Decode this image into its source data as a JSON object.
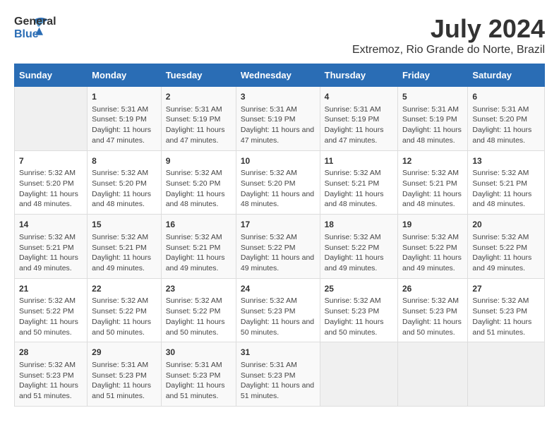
{
  "logo": {
    "text_general": "General",
    "text_blue": "Blue"
  },
  "title": "July 2024",
  "subtitle": "Extremoz, Rio Grande do Norte, Brazil",
  "days_of_week": [
    "Sunday",
    "Monday",
    "Tuesday",
    "Wednesday",
    "Thursday",
    "Friday",
    "Saturday"
  ],
  "weeks": [
    [
      {
        "day": "",
        "info": ""
      },
      {
        "day": "1",
        "info": "Sunrise: 5:31 AM\nSunset: 5:19 PM\nDaylight: 11 hours and 47 minutes."
      },
      {
        "day": "2",
        "info": "Sunrise: 5:31 AM\nSunset: 5:19 PM\nDaylight: 11 hours and 47 minutes."
      },
      {
        "day": "3",
        "info": "Sunrise: 5:31 AM\nSunset: 5:19 PM\nDaylight: 11 hours and 47 minutes."
      },
      {
        "day": "4",
        "info": "Sunrise: 5:31 AM\nSunset: 5:19 PM\nDaylight: 11 hours and 47 minutes."
      },
      {
        "day": "5",
        "info": "Sunrise: 5:31 AM\nSunset: 5:19 PM\nDaylight: 11 hours and 48 minutes."
      },
      {
        "day": "6",
        "info": "Sunrise: 5:31 AM\nSunset: 5:20 PM\nDaylight: 11 hours and 48 minutes."
      }
    ],
    [
      {
        "day": "7",
        "info": "Sunrise: 5:32 AM\nSunset: 5:20 PM\nDaylight: 11 hours and 48 minutes."
      },
      {
        "day": "8",
        "info": "Sunrise: 5:32 AM\nSunset: 5:20 PM\nDaylight: 11 hours and 48 minutes."
      },
      {
        "day": "9",
        "info": "Sunrise: 5:32 AM\nSunset: 5:20 PM\nDaylight: 11 hours and 48 minutes."
      },
      {
        "day": "10",
        "info": "Sunrise: 5:32 AM\nSunset: 5:20 PM\nDaylight: 11 hours and 48 minutes."
      },
      {
        "day": "11",
        "info": "Sunrise: 5:32 AM\nSunset: 5:21 PM\nDaylight: 11 hours and 48 minutes."
      },
      {
        "day": "12",
        "info": "Sunrise: 5:32 AM\nSunset: 5:21 PM\nDaylight: 11 hours and 48 minutes."
      },
      {
        "day": "13",
        "info": "Sunrise: 5:32 AM\nSunset: 5:21 PM\nDaylight: 11 hours and 48 minutes."
      }
    ],
    [
      {
        "day": "14",
        "info": "Sunrise: 5:32 AM\nSunset: 5:21 PM\nDaylight: 11 hours and 49 minutes."
      },
      {
        "day": "15",
        "info": "Sunrise: 5:32 AM\nSunset: 5:21 PM\nDaylight: 11 hours and 49 minutes."
      },
      {
        "day": "16",
        "info": "Sunrise: 5:32 AM\nSunset: 5:21 PM\nDaylight: 11 hours and 49 minutes."
      },
      {
        "day": "17",
        "info": "Sunrise: 5:32 AM\nSunset: 5:22 PM\nDaylight: 11 hours and 49 minutes."
      },
      {
        "day": "18",
        "info": "Sunrise: 5:32 AM\nSunset: 5:22 PM\nDaylight: 11 hours and 49 minutes."
      },
      {
        "day": "19",
        "info": "Sunrise: 5:32 AM\nSunset: 5:22 PM\nDaylight: 11 hours and 49 minutes."
      },
      {
        "day": "20",
        "info": "Sunrise: 5:32 AM\nSunset: 5:22 PM\nDaylight: 11 hours and 49 minutes."
      }
    ],
    [
      {
        "day": "21",
        "info": "Sunrise: 5:32 AM\nSunset: 5:22 PM\nDaylight: 11 hours and 50 minutes."
      },
      {
        "day": "22",
        "info": "Sunrise: 5:32 AM\nSunset: 5:22 PM\nDaylight: 11 hours and 50 minutes."
      },
      {
        "day": "23",
        "info": "Sunrise: 5:32 AM\nSunset: 5:22 PM\nDaylight: 11 hours and 50 minutes."
      },
      {
        "day": "24",
        "info": "Sunrise: 5:32 AM\nSunset: 5:23 PM\nDaylight: 11 hours and 50 minutes."
      },
      {
        "day": "25",
        "info": "Sunrise: 5:32 AM\nSunset: 5:23 PM\nDaylight: 11 hours and 50 minutes."
      },
      {
        "day": "26",
        "info": "Sunrise: 5:32 AM\nSunset: 5:23 PM\nDaylight: 11 hours and 50 minutes."
      },
      {
        "day": "27",
        "info": "Sunrise: 5:32 AM\nSunset: 5:23 PM\nDaylight: 11 hours and 51 minutes."
      }
    ],
    [
      {
        "day": "28",
        "info": "Sunrise: 5:32 AM\nSunset: 5:23 PM\nDaylight: 11 hours and 51 minutes."
      },
      {
        "day": "29",
        "info": "Sunrise: 5:31 AM\nSunset: 5:23 PM\nDaylight: 11 hours and 51 minutes."
      },
      {
        "day": "30",
        "info": "Sunrise: 5:31 AM\nSunset: 5:23 PM\nDaylight: 11 hours and 51 minutes."
      },
      {
        "day": "31",
        "info": "Sunrise: 5:31 AM\nSunset: 5:23 PM\nDaylight: 11 hours and 51 minutes."
      },
      {
        "day": "",
        "info": ""
      },
      {
        "day": "",
        "info": ""
      },
      {
        "day": "",
        "info": ""
      }
    ]
  ]
}
